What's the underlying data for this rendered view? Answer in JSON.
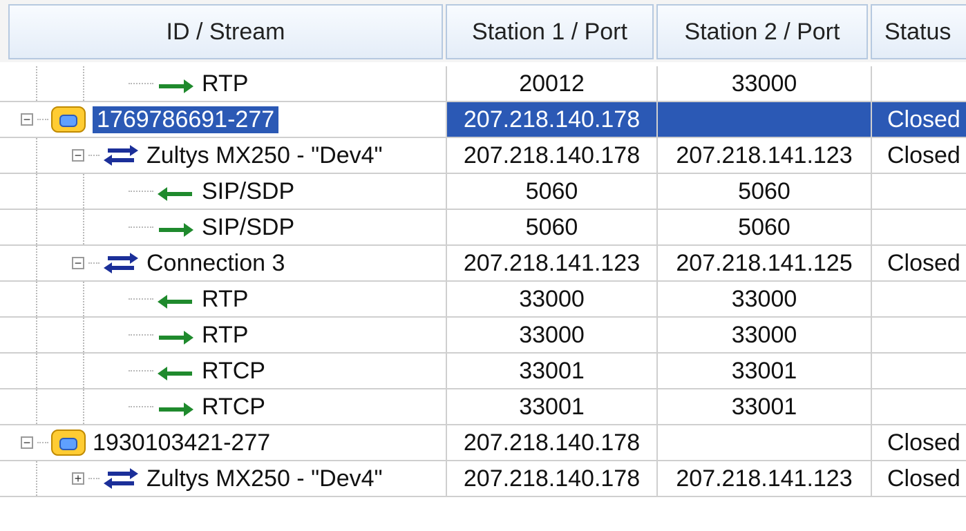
{
  "columns": {
    "id": "ID / Stream",
    "station1": "Station 1 / Port",
    "station2": "Station 2 / Port",
    "status": "Status"
  },
  "rows": [
    {
      "label": "RTP",
      "station1": "20012",
      "station2": "33000",
      "status": "",
      "type": "stream-right",
      "level": 2
    },
    {
      "label": "1769786691-277",
      "station1": "207.218.140.178",
      "station2": "",
      "status": "Closed",
      "type": "call",
      "level": 0,
      "selected": true,
      "expanded": true
    },
    {
      "label": "Zultys MX250 - \"Dev4\"",
      "station1": "207.218.140.178",
      "station2": "207.218.141.123",
      "status": "Closed",
      "type": "connection",
      "level": 1,
      "expanded": true
    },
    {
      "label": "SIP/SDP",
      "station1": "5060",
      "station2": "5060",
      "status": "",
      "type": "stream-left",
      "level": 2
    },
    {
      "label": "SIP/SDP",
      "station1": "5060",
      "station2": "5060",
      "status": "",
      "type": "stream-right",
      "level": 2
    },
    {
      "label": "Connection 3",
      "station1": "207.218.141.123",
      "station2": "207.218.141.125",
      "status": "Closed",
      "type": "connection",
      "level": 1,
      "expanded": true
    },
    {
      "label": "RTP",
      "station1": "33000",
      "station2": "33000",
      "status": "",
      "type": "stream-left",
      "level": 2
    },
    {
      "label": "RTP",
      "station1": "33000",
      "station2": "33000",
      "status": "",
      "type": "stream-right",
      "level": 2
    },
    {
      "label": "RTCP",
      "station1": "33001",
      "station2": "33001",
      "status": "",
      "type": "stream-left",
      "level": 2
    },
    {
      "label": "RTCP",
      "station1": "33001",
      "station2": "33001",
      "status": "",
      "type": "stream-right",
      "level": 2
    },
    {
      "label": "1930103421-277",
      "station1": "207.218.140.178",
      "station2": "",
      "status": "Closed",
      "type": "call",
      "level": 0,
      "expanded": true
    },
    {
      "label": "Zultys MX250 - \"Dev4\"",
      "station1": "207.218.140.178",
      "station2": "207.218.141.123",
      "status": "Closed",
      "type": "connection",
      "level": 1,
      "expanded": false
    }
  ],
  "icons": {
    "call": "phone-icon",
    "connection": "connection-icon",
    "stream-left": "arrow-left-icon",
    "stream-right": "arrow-right-icon"
  },
  "colors": {
    "selected": "#2b59b5",
    "arrow": "#1f8a2d",
    "connection": "#1b2f99"
  }
}
